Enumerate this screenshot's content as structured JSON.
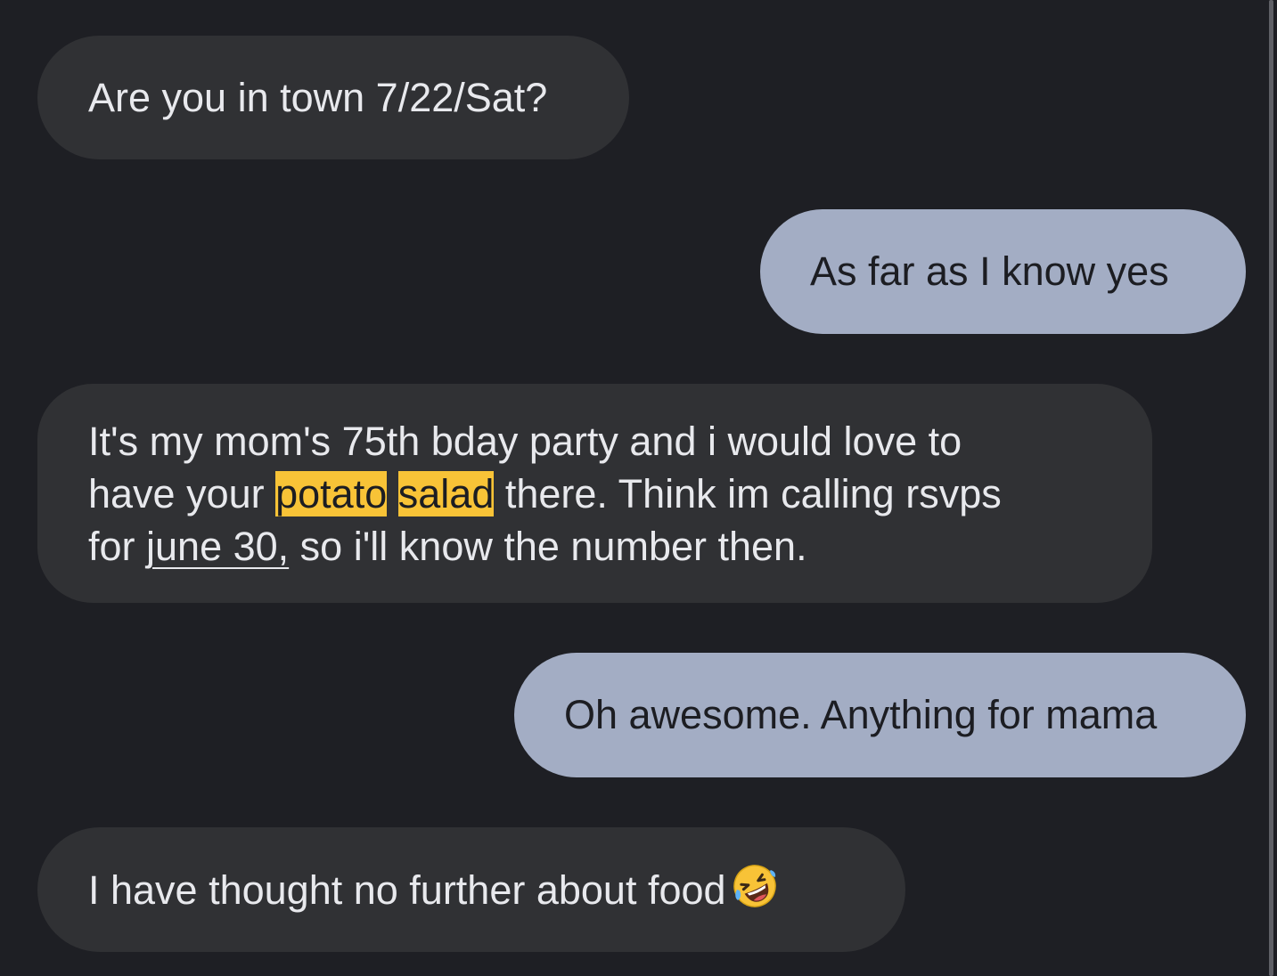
{
  "conversation": {
    "messages": [
      {
        "direction": "incoming",
        "lines": [
          "Are you in town 7/22/Sat?"
        ]
      },
      {
        "direction": "outgoing",
        "lines": [
          "As far as I know yes"
        ]
      },
      {
        "direction": "incoming",
        "line1": "It's my mom's 75th bday party and i would love to",
        "line2_prefix": "have your ",
        "highlight_1": "potato",
        "highlight_2": "salad",
        "line2_suffix": " there. Think im calling rsvps",
        "line3_prefix": "for ",
        "date_link": "june 30,",
        "line3_suffix": " so i'll know the number then."
      },
      {
        "direction": "outgoing",
        "lines": [
          "Oh awesome. Anything for mama"
        ]
      },
      {
        "direction": "incoming",
        "text": "I have thought no further about food",
        "emoji": "rolling-on-floor-laughing-icon"
      }
    ]
  },
  "colors": {
    "background": "#1e1f24",
    "incoming_bubble": "#303134",
    "outgoing_bubble": "#a3adc4",
    "highlight": "#f8c337"
  }
}
